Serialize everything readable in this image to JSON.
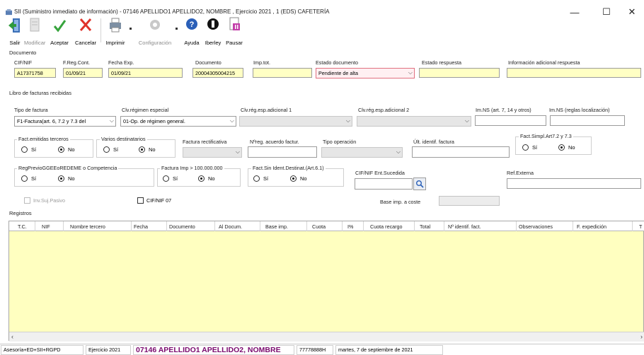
{
  "window": {
    "title": "SII (Suministro inmediato de información) - 07146 APELLIDO1 APELLIDO2, NOMBRE , Ejercicio 2021 , 1  (EDS) CAFETERÍA",
    "minimize": "—",
    "maximize": "☐",
    "close": "✕"
  },
  "toolbar": {
    "salir": "Salir",
    "modificar": "Modificar",
    "aceptar": "Aceptar",
    "cancelar": "Cancelar",
    "imprimir": "Imprimir",
    "configuracion": "Configuración",
    "ayuda": "Ayuda",
    "iberley": "Iberley",
    "pausar": "Pausar"
  },
  "documento": {
    "section": "Documento",
    "labels": {
      "cif": "CIF/NIF",
      "freg": "F.Reg.Cont.",
      "fexp": "Fecha Exp.",
      "doc": "Documento",
      "imptot": "Imp.tot.",
      "estado": "Estado documento",
      "estado_resp": "Estado respuesta",
      "info_adic": "Información adicional respuesta"
    },
    "values": {
      "cif": "A17371758",
      "freg": "01/09/21",
      "fexp": "01/09/21",
      "doc": "20004305004215",
      "imptot": "",
      "estado": "Pendiente de alta",
      "estado_resp": "",
      "info_adic": ""
    }
  },
  "libro": {
    "section": "Libro de facturas recibidas",
    "labels": {
      "tipo": "Tipo de factura",
      "clv_reg": "Clv.régimen especial",
      "clv_adic1": "Clv.rég.esp.adicional 1",
      "clv_adic2": "Clv.rég.esp.adicional 2",
      "imns1": "Im.NS (art. 7, 14 y otros)",
      "imns2": "Im.NS (reglas localización)",
      "fact_terceros": "Fact.emitidas terceros",
      "varios_dest": "Varios destinatarios",
      "fact_rect": "Factura rectificativa",
      "nreg_acuerdo": "Nºreg. acuerdo factur.",
      "tipo_op": "Tipo operación",
      "ult_ident": "Últ. identif. factura",
      "fact_simpl": "Fact.Simpl.Art7.2 y 7.3",
      "reg_previo": "RegPrevioGGEEoREDEME o Competencia",
      "fact_imp": "Factura Imp > 100.000.000",
      "fact_sin_ident": "Fact.Sin Ident.Destinat.(Art.6.1)",
      "cif_sucedida": "CIF/NIF Ent.Sucedida",
      "ref_externa": "Ref.Externa",
      "inv_suj": "Inv.Suj.Pasivo",
      "cif07": "CIF/NIF 07",
      "base_coste": "Base imp. a coste"
    },
    "values": {
      "tipo": "F1-Factura(art. 6, 7.2 y 7.3 del",
      "clv_reg": "01-Op. de régimen general.",
      "clv_adic1": "",
      "clv_adic2": "",
      "si": "Sí",
      "no": "No"
    }
  },
  "registros": {
    "section": "Registros",
    "columns": [
      "T.C.",
      "NIF",
      "Nombre tercero",
      "Fecha",
      "Documento",
      "Al Docum.",
      "Base imp.",
      "Cuota",
      "I%",
      "Cuota recargo",
      "Total",
      "Nº identif. fact.",
      "Observaciones",
      "F. expedición",
      "T"
    ]
  },
  "status": {
    "cell1": "Asesoría+ED+SII+RGPD",
    "cell2": "Ejercicio 2021",
    "cell3": "07146 APELLIDO1 APELLIDO2, NOMBRE",
    "cell4": "77778888H",
    "cell5": "martes, 7 de septiembre de 2021"
  },
  "colors": {
    "yellow_field": "#ffffc4",
    "grid_bg": "#ffffc0",
    "accent_status": "#7a0a6f",
    "desktop": "#2f8d96"
  }
}
